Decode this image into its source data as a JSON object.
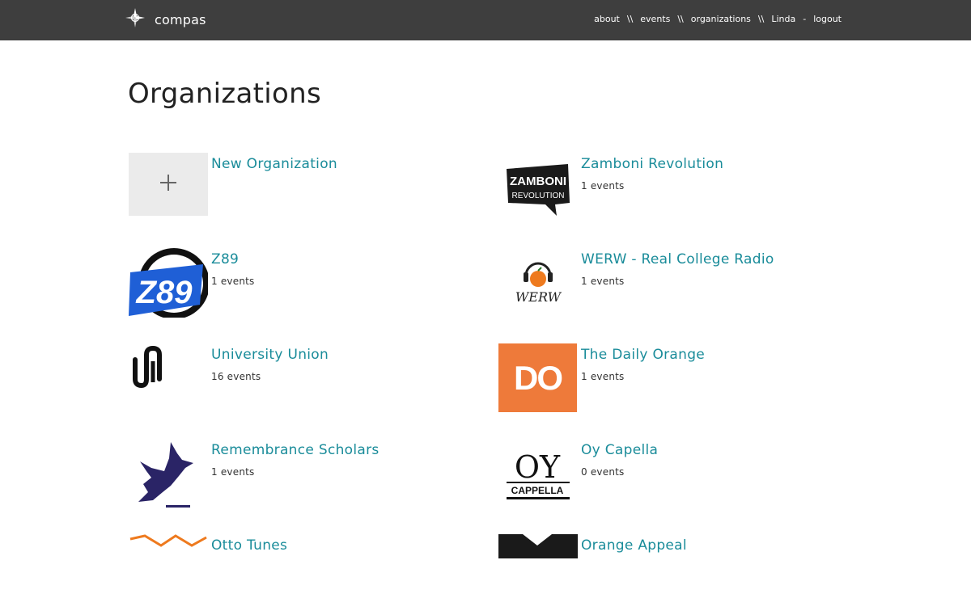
{
  "header": {
    "brand": "compas",
    "nav": [
      {
        "label": "about"
      },
      {
        "label": "events"
      },
      {
        "label": "organizations"
      },
      {
        "label": "Linda"
      },
      {
        "label": "logout"
      }
    ],
    "separators": [
      "\\\\",
      "\\\\",
      "\\\\",
      "-"
    ]
  },
  "page": {
    "title": "Organizations"
  },
  "organizations": [
    {
      "name": "New Organization",
      "icon": "plus-icon"
    },
    {
      "name": "Zamboni Revolution",
      "count": "1 events",
      "logo_text": "ZAMBONI",
      "logo_text2": "REVOLUTION"
    },
    {
      "name": "Z89",
      "count": "1 events",
      "logo_text": "Z89"
    },
    {
      "name": "WERW - Real College Radio",
      "count": "1 events",
      "logo_text": "WERW"
    },
    {
      "name": "University Union",
      "count": "16 events"
    },
    {
      "name": "The Daily Orange",
      "count": "1 events",
      "logo_text": "DO"
    },
    {
      "name": "Remembrance Scholars",
      "count": "1 events"
    },
    {
      "name": "Oy Capella",
      "count": "0 events",
      "logo_text": "OY",
      "logo_text2": "CAPPELLA"
    },
    {
      "name": "Otto Tunes"
    },
    {
      "name": "Orange Appeal"
    }
  ],
  "colors": {
    "header_bg": "#3e3e3e",
    "link": "#1a8c9a",
    "daily_orange": "#ee7a3a",
    "z89_blue": "#1f5fd6",
    "dove_navy": "#2a2466"
  }
}
